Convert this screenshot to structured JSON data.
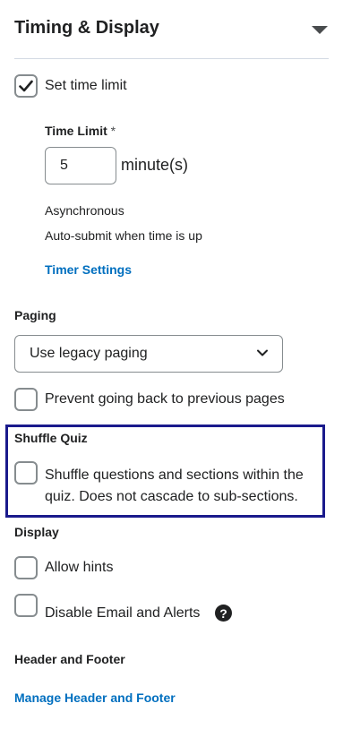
{
  "section": {
    "title": "Timing & Display"
  },
  "time_limit": {
    "checkbox_label": "Set time limit",
    "checked": true,
    "field_label": "Time Limit",
    "required_mark": "*",
    "value": "5",
    "unit": "minute(s)",
    "mode": "Asynchronous",
    "behavior": "Auto-submit when time is up",
    "settings_link": "Timer Settings"
  },
  "paging": {
    "heading": "Paging",
    "select_value": "Use legacy paging",
    "prevent_back_label": "Prevent going back to previous pages"
  },
  "shuffle": {
    "heading": "Shuffle Quiz",
    "line1": "Shuffle questions and sections within the",
    "line2": "quiz. Does not cascade to sub-sections."
  },
  "display": {
    "heading": "Display",
    "allow_hints_label": "Allow hints",
    "disable_email_label": "Disable Email and Alerts",
    "help_glyph": "?"
  },
  "header_footer": {
    "heading": "Header and Footer",
    "manage_link": "Manage Header and Footer"
  },
  "colors": {
    "accent_link": "#006fbf",
    "highlight_border": "#1a1a8c",
    "checkbox_border": "#868c8f"
  }
}
